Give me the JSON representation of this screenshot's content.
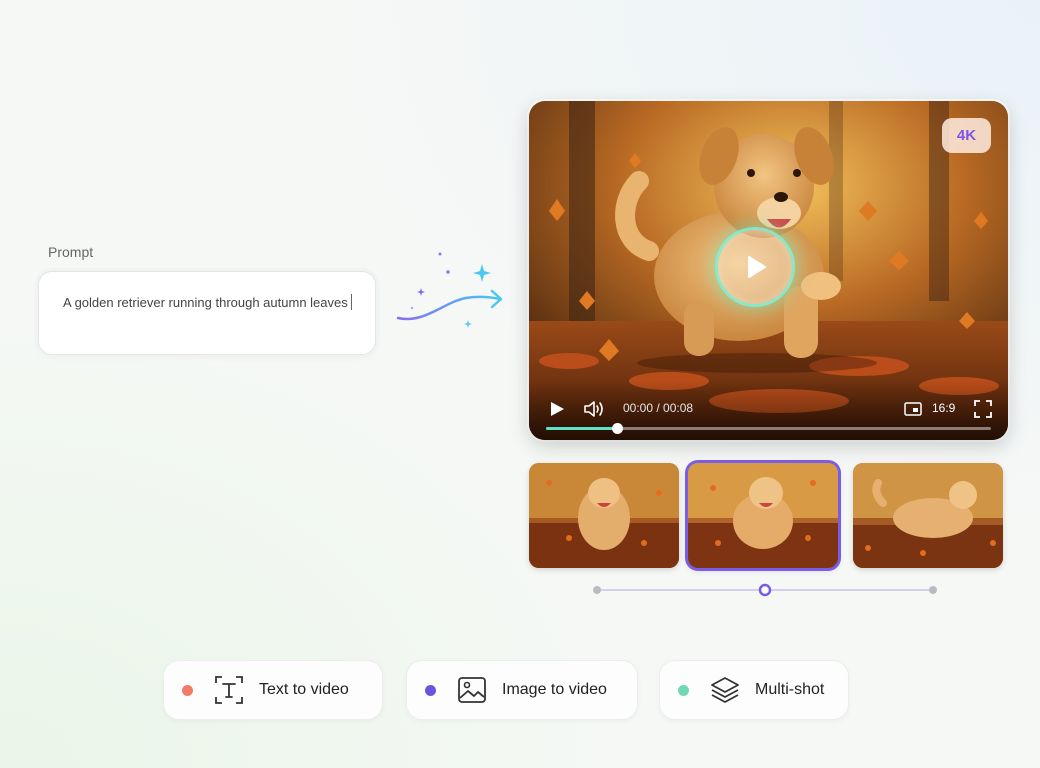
{
  "prompt": {
    "label": "Prompt",
    "value": "A golden retriever running through autumn leaves"
  },
  "player": {
    "quality_badge": "4K",
    "time": "00:00 / 00:08",
    "aspect_ratio": "16:9",
    "progress": 0.16
  },
  "thumbnails": {
    "count": 3,
    "selected_index": 1
  },
  "modes": [
    {
      "label": "Text to video",
      "dot_color": "#f07b67",
      "icon": "text-frame-icon"
    },
    {
      "label": "Image to video",
      "dot_color": "#6a55e0",
      "icon": "image-icon"
    },
    {
      "label": "Multi-shot",
      "dot_color": "#6fd8b4",
      "icon": "layers-icon"
    }
  ],
  "colors": {
    "accent": "#7b5ce6",
    "progress": "#5fe3c4"
  }
}
